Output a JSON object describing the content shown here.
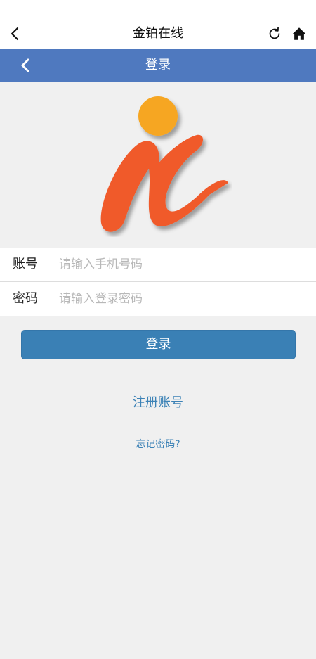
{
  "app": {
    "title": "金铂在线"
  },
  "header": {
    "title": "登录"
  },
  "form": {
    "account_label": "账号",
    "account_placeholder": "请输入手机号码",
    "password_label": "密码",
    "password_placeholder": "请输入登录密码"
  },
  "actions": {
    "login_label": "登录",
    "register_label": "注册账号",
    "forgot_label": "忘记密码?"
  },
  "colors": {
    "header_bg": "#4f79bf",
    "login_button": "#3a80b5",
    "link": "#3c82b6",
    "logo_orange": "#f6a623",
    "logo_red": "#f05a2c"
  },
  "icons": [
    "back-icon",
    "refresh-icon",
    "home-icon",
    "header-back-icon"
  ]
}
